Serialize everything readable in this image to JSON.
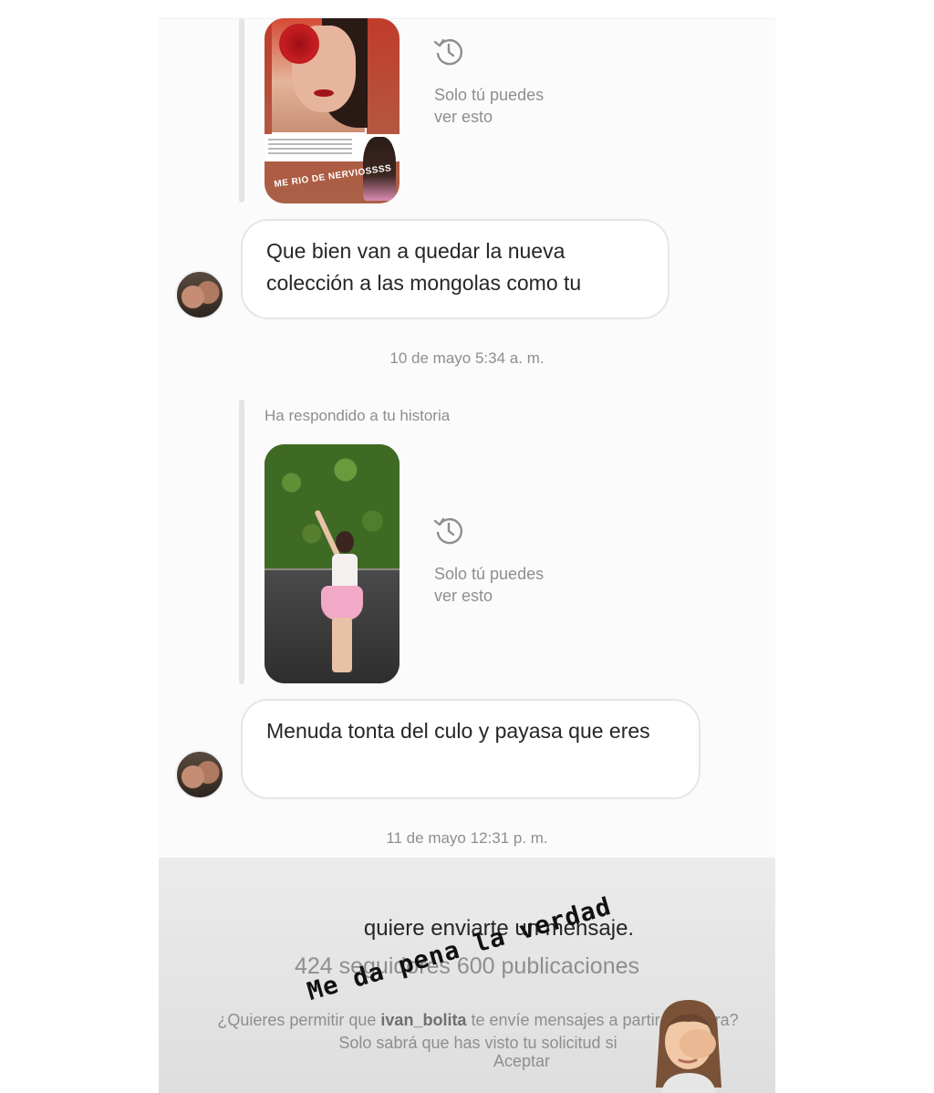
{
  "conversation": {
    "ephemeral_note_1": "Solo tú puedes\nver esto",
    "story_1_sticker": "ME RIO DE NERVIOSSSS",
    "message_1": "Que bien van a quedar la nueva colección a las mongolas como tu",
    "timestamp_1": "10 de mayo 5:34 a. m.",
    "reply_label": "Ha respondido a tu historia",
    "ephemeral_note_2": "Solo tú puedes\nver esto",
    "message_2": "Menuda tonta del culo y payasa que eres",
    "timestamp_2": "11 de mayo 12:31 p. m."
  },
  "request": {
    "title": "quiere enviarte un mensaje.",
    "stats": "424 seguidores 600 publicaciones",
    "question_prefix": "¿Quieres permitir que ",
    "username": "ivan_bolita",
    "question_suffix": " te envíe mensajes a partir de ahora? Solo sabrá que has visto tu solicitud si",
    "accept_label": "Aceptar"
  },
  "overlay": {
    "sticker_text": "Me da pena la verdad"
  },
  "icons": [
    "clock-history-icon",
    "avatar-photo",
    "memoji-facepalm"
  ]
}
